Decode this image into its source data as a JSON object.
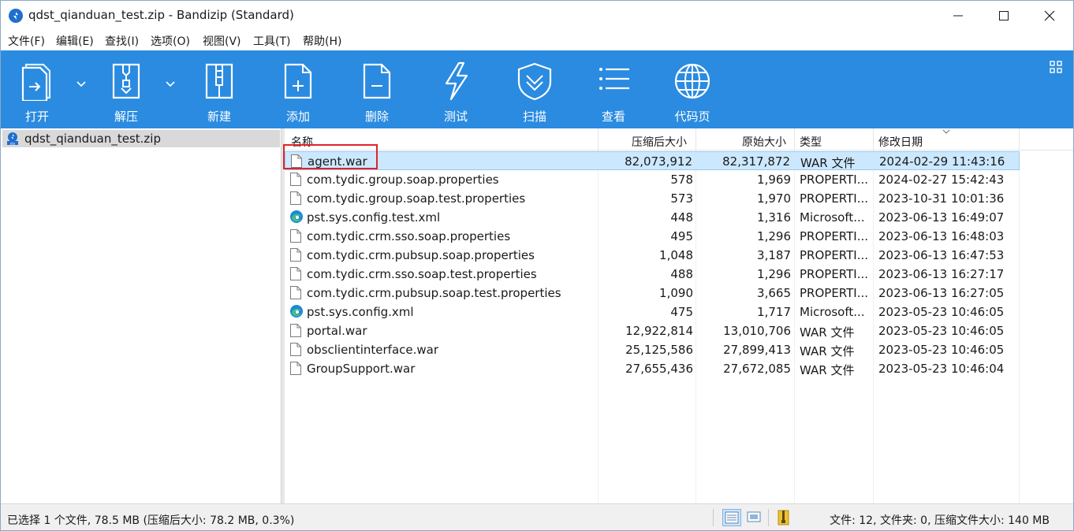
{
  "window": {
    "title": "qdst_qianduan_test.zip - Bandizip (Standard)"
  },
  "menu": [
    {
      "label": "文件(F)"
    },
    {
      "label": "编辑(E)"
    },
    {
      "label": "查找(I)"
    },
    {
      "label": "选项(O)"
    },
    {
      "label": "视图(V)"
    },
    {
      "label": "工具(T)"
    },
    {
      "label": "帮助(H)"
    }
  ],
  "toolbar": {
    "open": "打开",
    "extract": "解压",
    "new": "新建",
    "add": "添加",
    "delete": "删除",
    "test": "测试",
    "scan": "扫描",
    "view": "查看",
    "codepage": "代码页",
    "accent_color": "#2a8be0"
  },
  "tree": {
    "item": "qdst_qianduan_test.zip"
  },
  "columns": {
    "name": "名称",
    "compressed": "压缩后大小",
    "original": "原始大小",
    "type": "类型",
    "modified": "修改日期"
  },
  "files": [
    {
      "name": "agent.war",
      "compressed": "82,073,912",
      "original": "82,317,872",
      "type": "WAR 文件",
      "modified": "2024-02-29 11:43:16",
      "icon": "file-icon",
      "selected": true
    },
    {
      "name": "com.tydic.group.soap.properties",
      "compressed": "578",
      "original": "1,969",
      "type": "PROPERTI...",
      "modified": "2024-02-27 15:42:43",
      "icon": "file-icon"
    },
    {
      "name": "com.tydic.group.soap.test.properties",
      "compressed": "573",
      "original": "1,970",
      "type": "PROPERTI...",
      "modified": "2023-10-31 10:01:36",
      "icon": "file-icon"
    },
    {
      "name": "pst.sys.config.test.xml",
      "compressed": "448",
      "original": "1,316",
      "type": "Microsoft...",
      "modified": "2023-06-13 16:49:07",
      "icon": "edge-icon"
    },
    {
      "name": "com.tydic.crm.sso.soap.properties",
      "compressed": "495",
      "original": "1,296",
      "type": "PROPERTI...",
      "modified": "2023-06-13 16:48:03",
      "icon": "file-icon"
    },
    {
      "name": "com.tydic.crm.pubsup.soap.properties",
      "compressed": "1,048",
      "original": "3,187",
      "type": "PROPERTI...",
      "modified": "2023-06-13 16:47:53",
      "icon": "file-icon"
    },
    {
      "name": "com.tydic.crm.sso.soap.test.properties",
      "compressed": "488",
      "original": "1,296",
      "type": "PROPERTI...",
      "modified": "2023-06-13 16:27:17",
      "icon": "file-icon"
    },
    {
      "name": "com.tydic.crm.pubsup.soap.test.properties",
      "compressed": "1,090",
      "original": "3,665",
      "type": "PROPERTI...",
      "modified": "2023-06-13 16:27:05",
      "icon": "file-icon"
    },
    {
      "name": "pst.sys.config.xml",
      "compressed": "475",
      "original": "1,717",
      "type": "Microsoft...",
      "modified": "2023-05-23 10:46:05",
      "icon": "edge-icon"
    },
    {
      "name": "portal.war",
      "compressed": "12,922,814",
      "original": "13,010,706",
      "type": "WAR 文件",
      "modified": "2023-05-23 10:46:05",
      "icon": "file-icon"
    },
    {
      "name": "obsclientinterface.war",
      "compressed": "25,125,586",
      "original": "27,899,413",
      "type": "WAR 文件",
      "modified": "2023-05-23 10:46:05",
      "icon": "file-icon"
    },
    {
      "name": "GroupSupport.war",
      "compressed": "27,655,436",
      "original": "27,672,085",
      "type": "WAR 文件",
      "modified": "2023-05-23 10:46:04",
      "icon": "file-icon"
    }
  ],
  "status": {
    "left": "已选择 1 个文件, 78.5 MB (压缩后大小: 78.2 MB, 0.3%)",
    "right": "文件: 12, 文件夹: 0, 压缩文件大小: 140 MB"
  }
}
